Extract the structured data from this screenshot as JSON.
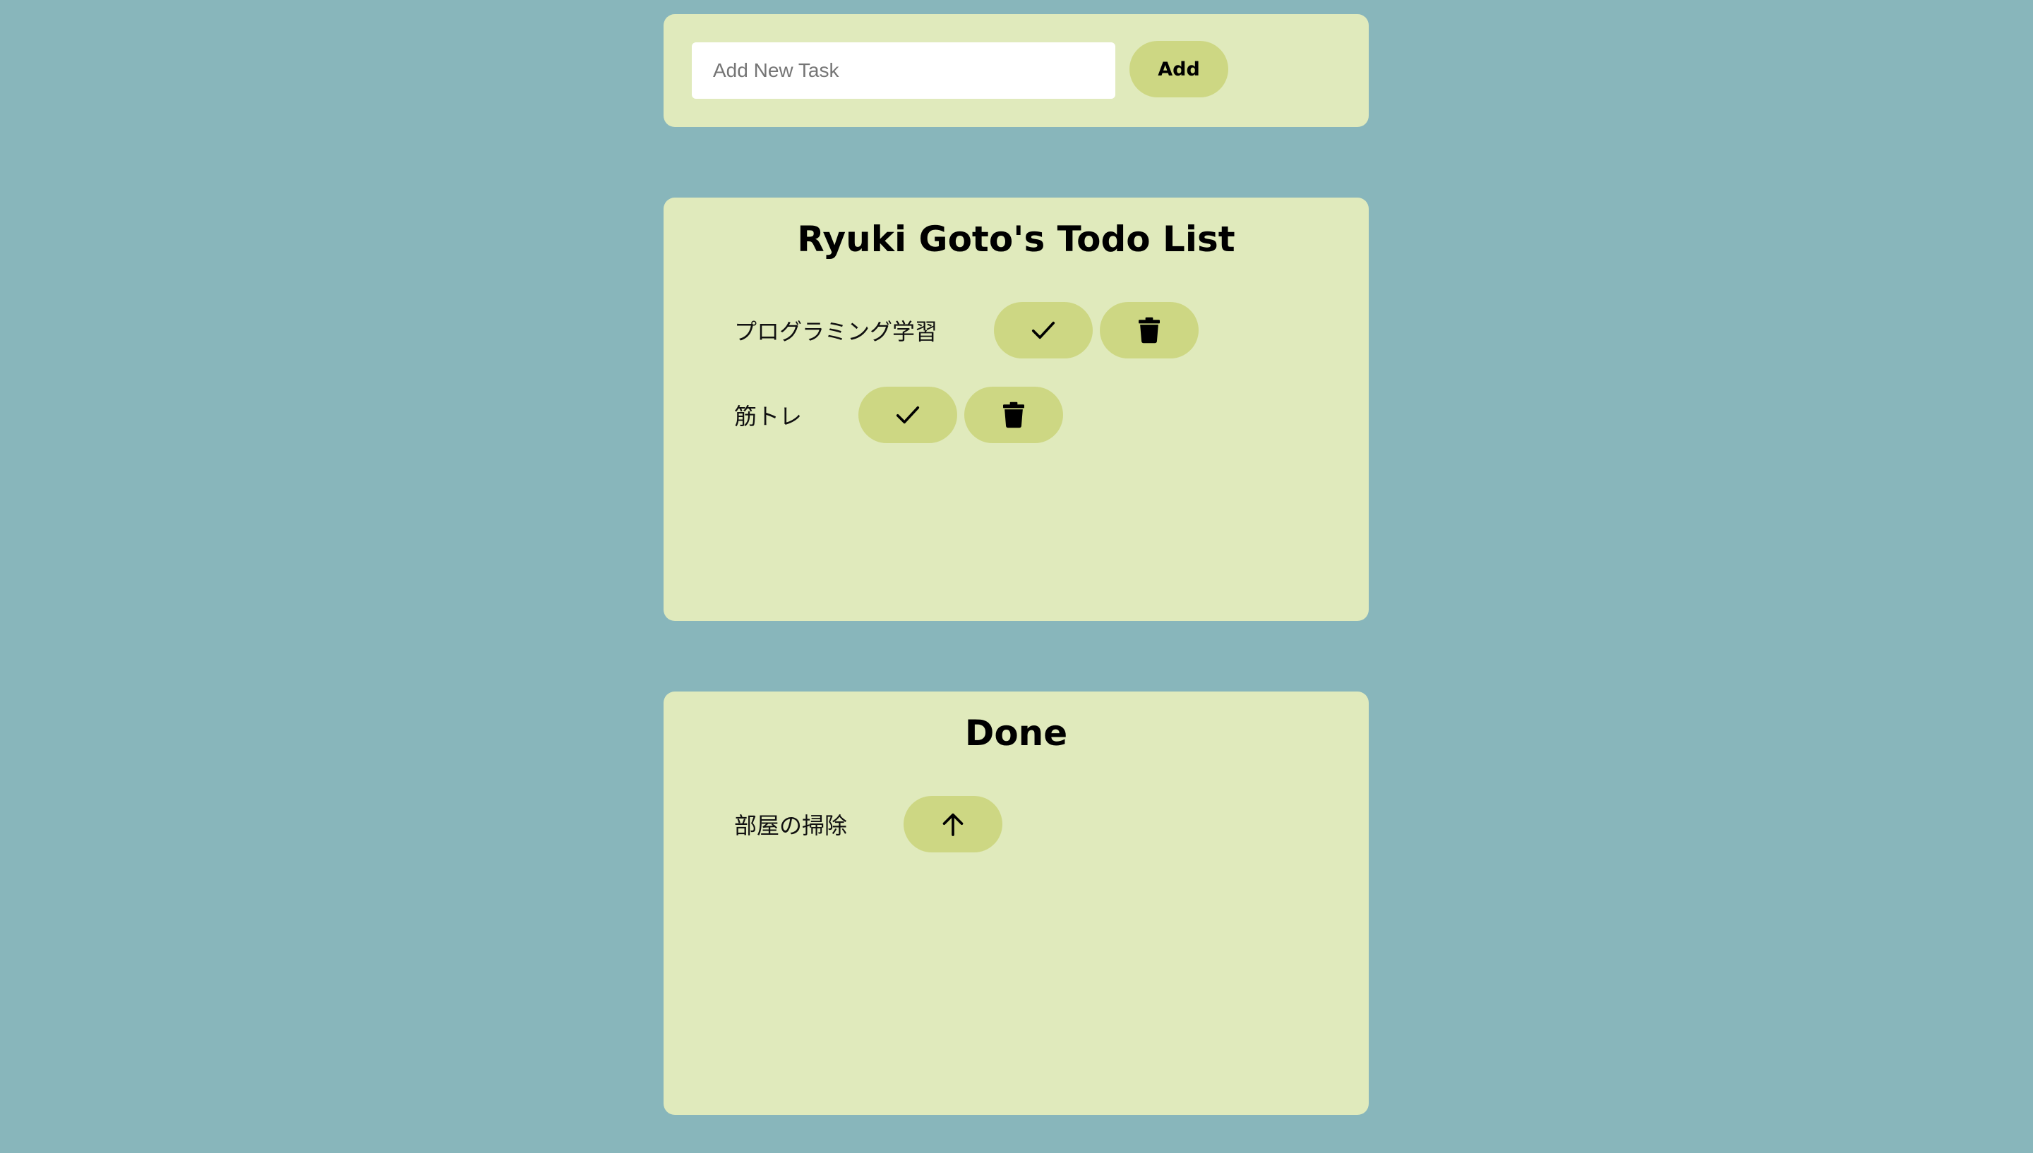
{
  "add_form": {
    "placeholder": "Add New Task",
    "value": "",
    "add_label": "Add"
  },
  "todo": {
    "title": "Ryuki Goto's Todo List",
    "items": [
      {
        "text": "プログラミング学習",
        "actions": [
          "check-icon",
          "trash-icon"
        ]
      },
      {
        "text": "筋トレ",
        "actions": [
          "check-icon",
          "trash-icon"
        ]
      }
    ]
  },
  "done": {
    "title": "Done",
    "items": [
      {
        "text": "部屋の掃除",
        "actions": [
          "arrow-up-icon"
        ]
      }
    ]
  },
  "colors": {
    "background": "#88b6bb",
    "panel": "#e0eabc",
    "button": "#cdd783"
  }
}
